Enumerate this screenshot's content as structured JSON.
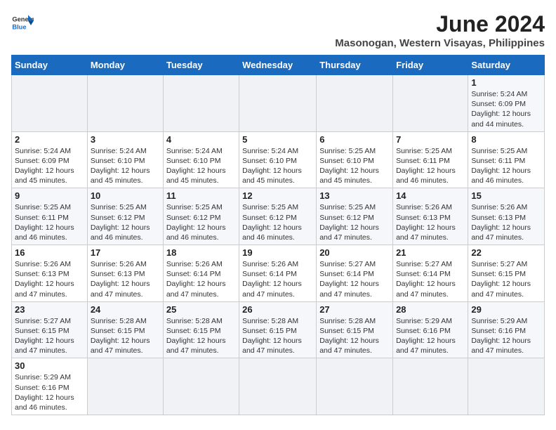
{
  "header": {
    "logo_line1": "General",
    "logo_line2": "Blue",
    "title": "June 2024",
    "subtitle": "Masonogan, Western Visayas, Philippines"
  },
  "weekdays": [
    "Sunday",
    "Monday",
    "Tuesday",
    "Wednesday",
    "Thursday",
    "Friday",
    "Saturday"
  ],
  "weeks": [
    [
      {
        "day": "",
        "info": ""
      },
      {
        "day": "",
        "info": ""
      },
      {
        "day": "",
        "info": ""
      },
      {
        "day": "",
        "info": ""
      },
      {
        "day": "",
        "info": ""
      },
      {
        "day": "",
        "info": ""
      },
      {
        "day": "1",
        "info": "Sunrise: 5:24 AM\nSunset: 6:09 PM\nDaylight: 12 hours\nand 44 minutes."
      }
    ],
    [
      {
        "day": "2",
        "info": "Sunrise: 5:24 AM\nSunset: 6:09 PM\nDaylight: 12 hours\nand 45 minutes."
      },
      {
        "day": "3",
        "info": "Sunrise: 5:24 AM\nSunset: 6:10 PM\nDaylight: 12 hours\nand 45 minutes."
      },
      {
        "day": "4",
        "info": "Sunrise: 5:24 AM\nSunset: 6:10 PM\nDaylight: 12 hours\nand 45 minutes."
      },
      {
        "day": "5",
        "info": "Sunrise: 5:24 AM\nSunset: 6:10 PM\nDaylight: 12 hours\nand 45 minutes."
      },
      {
        "day": "6",
        "info": "Sunrise: 5:25 AM\nSunset: 6:10 PM\nDaylight: 12 hours\nand 45 minutes."
      },
      {
        "day": "7",
        "info": "Sunrise: 5:25 AM\nSunset: 6:11 PM\nDaylight: 12 hours\nand 46 minutes."
      },
      {
        "day": "8",
        "info": "Sunrise: 5:25 AM\nSunset: 6:11 PM\nDaylight: 12 hours\nand 46 minutes."
      }
    ],
    [
      {
        "day": "9",
        "info": "Sunrise: 5:25 AM\nSunset: 6:11 PM\nDaylight: 12 hours\nand 46 minutes."
      },
      {
        "day": "10",
        "info": "Sunrise: 5:25 AM\nSunset: 6:12 PM\nDaylight: 12 hours\nand 46 minutes."
      },
      {
        "day": "11",
        "info": "Sunrise: 5:25 AM\nSunset: 6:12 PM\nDaylight: 12 hours\nand 46 minutes."
      },
      {
        "day": "12",
        "info": "Sunrise: 5:25 AM\nSunset: 6:12 PM\nDaylight: 12 hours\nand 46 minutes."
      },
      {
        "day": "13",
        "info": "Sunrise: 5:25 AM\nSunset: 6:12 PM\nDaylight: 12 hours\nand 47 minutes."
      },
      {
        "day": "14",
        "info": "Sunrise: 5:26 AM\nSunset: 6:13 PM\nDaylight: 12 hours\nand 47 minutes."
      },
      {
        "day": "15",
        "info": "Sunrise: 5:26 AM\nSunset: 6:13 PM\nDaylight: 12 hours\nand 47 minutes."
      }
    ],
    [
      {
        "day": "16",
        "info": "Sunrise: 5:26 AM\nSunset: 6:13 PM\nDaylight: 12 hours\nand 47 minutes."
      },
      {
        "day": "17",
        "info": "Sunrise: 5:26 AM\nSunset: 6:13 PM\nDaylight: 12 hours\nand 47 minutes."
      },
      {
        "day": "18",
        "info": "Sunrise: 5:26 AM\nSunset: 6:14 PM\nDaylight: 12 hours\nand 47 minutes."
      },
      {
        "day": "19",
        "info": "Sunrise: 5:26 AM\nSunset: 6:14 PM\nDaylight: 12 hours\nand 47 minutes."
      },
      {
        "day": "20",
        "info": "Sunrise: 5:27 AM\nSunset: 6:14 PM\nDaylight: 12 hours\nand 47 minutes."
      },
      {
        "day": "21",
        "info": "Sunrise: 5:27 AM\nSunset: 6:14 PM\nDaylight: 12 hours\nand 47 minutes."
      },
      {
        "day": "22",
        "info": "Sunrise: 5:27 AM\nSunset: 6:15 PM\nDaylight: 12 hours\nand 47 minutes."
      }
    ],
    [
      {
        "day": "23",
        "info": "Sunrise: 5:27 AM\nSunset: 6:15 PM\nDaylight: 12 hours\nand 47 minutes."
      },
      {
        "day": "24",
        "info": "Sunrise: 5:28 AM\nSunset: 6:15 PM\nDaylight: 12 hours\nand 47 minutes."
      },
      {
        "day": "25",
        "info": "Sunrise: 5:28 AM\nSunset: 6:15 PM\nDaylight: 12 hours\nand 47 minutes."
      },
      {
        "day": "26",
        "info": "Sunrise: 5:28 AM\nSunset: 6:15 PM\nDaylight: 12 hours\nand 47 minutes."
      },
      {
        "day": "27",
        "info": "Sunrise: 5:28 AM\nSunset: 6:15 PM\nDaylight: 12 hours\nand 47 minutes."
      },
      {
        "day": "28",
        "info": "Sunrise: 5:29 AM\nSunset: 6:16 PM\nDaylight: 12 hours\nand 47 minutes."
      },
      {
        "day": "29",
        "info": "Sunrise: 5:29 AM\nSunset: 6:16 PM\nDaylight: 12 hours\nand 47 minutes."
      }
    ],
    [
      {
        "day": "30",
        "info": "Sunrise: 5:29 AM\nSunset: 6:16 PM\nDaylight: 12 hours\nand 46 minutes."
      },
      {
        "day": "",
        "info": ""
      },
      {
        "day": "",
        "info": ""
      },
      {
        "day": "",
        "info": ""
      },
      {
        "day": "",
        "info": ""
      },
      {
        "day": "",
        "info": ""
      },
      {
        "day": "",
        "info": ""
      }
    ]
  ]
}
